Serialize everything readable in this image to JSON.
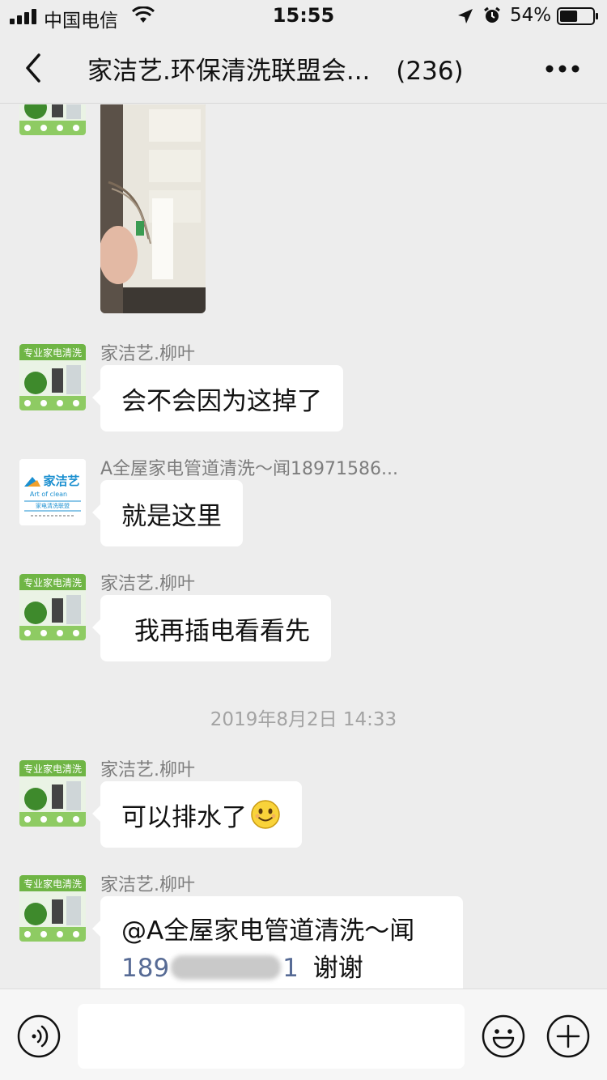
{
  "status_bar": {
    "carrier": "中国电信",
    "time": "15:55",
    "battery_percent": "54%",
    "battery_level": 0.54
  },
  "nav": {
    "title": "家洁艺.环保清洗联盟会...",
    "member_count": "(236)"
  },
  "avatars": {
    "liuye_banner_text": "专业家电清洗",
    "brand_logo_text": "家洁艺",
    "brand_logo_sub": "Art of clean",
    "brand_logo_tag": "家电清洗联盟"
  },
  "messages": [
    {
      "type": "image",
      "sender": "",
      "description": "photo"
    },
    {
      "type": "text",
      "sender": "家洁艺.柳叶",
      "text": "会不会因为这掉了"
    },
    {
      "type": "text",
      "sender": "A全屋家电管道清洗～闻18971586...",
      "text": "就是这里"
    },
    {
      "type": "text",
      "sender": "家洁艺.柳叶",
      "text": "我再插电看看先"
    },
    {
      "type": "time",
      "text": "2019年8月2日 14:33"
    },
    {
      "type": "text",
      "sender": "家洁艺.柳叶",
      "text": "可以排水了",
      "emoji": "smile-emoji"
    },
    {
      "type": "text",
      "sender": "家洁艺.柳叶",
      "text_line1": "@A全屋家电管道清洗～闻",
      "phone_start": "189",
      "phone_end": "1",
      "text_tail": "谢谢"
    }
  ],
  "input": {
    "value": "",
    "placeholder": ""
  },
  "colors": {
    "background": "#ededed",
    "bubble": "#ffffff",
    "link": "#576b95",
    "timestamp": "#a3a3a3"
  }
}
